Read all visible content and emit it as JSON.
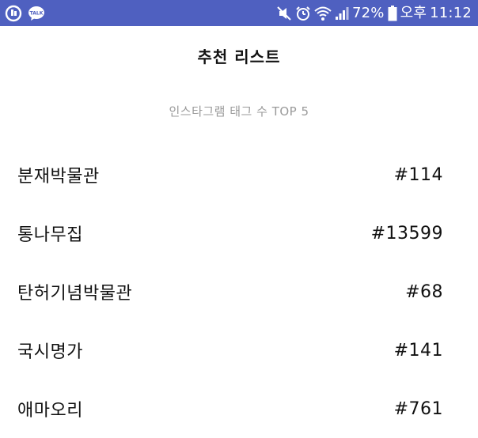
{
  "status_bar": {
    "left_icons": [
      "app-notification-icon",
      "kakaotalk-icon"
    ],
    "kakaotalk_badge": "TALK",
    "right_icons": [
      "mute-icon",
      "alarm-icon",
      "wifi-icon",
      "signal-icon",
      "battery-icon"
    ],
    "battery_percent": "72%",
    "ampm": "오후",
    "time": "11:12",
    "background_color": "#4f60c0"
  },
  "header": {
    "title": "추천 리스트"
  },
  "subtitle": "인스타그램 태그 수 TOP 5",
  "list": {
    "items": [
      {
        "name": "분재박물관",
        "count": "#114"
      },
      {
        "name": "통나무집",
        "count": "#13599"
      },
      {
        "name": "탄허기념박물관",
        "count": "#68"
      },
      {
        "name": "국시명가",
        "count": "#141"
      },
      {
        "name": "애마오리",
        "count": "#761"
      }
    ]
  }
}
